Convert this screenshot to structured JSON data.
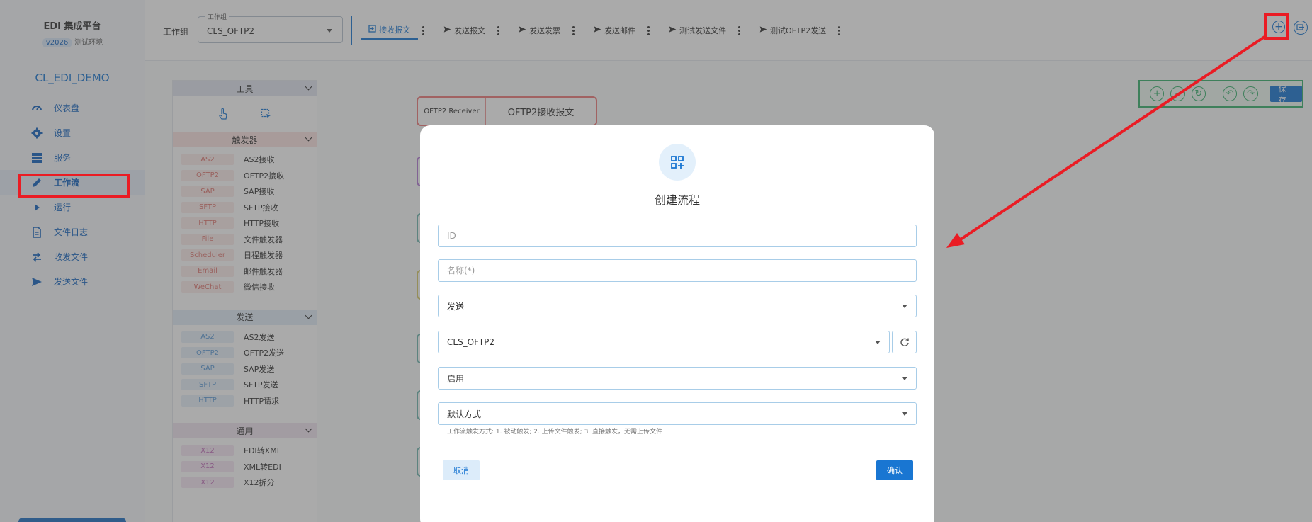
{
  "brand": {
    "title": "EDI 集成平台",
    "version": "v2026",
    "env": "测试环境"
  },
  "org_name": "CL_EDI_DEMO",
  "nav": [
    {
      "label": "仪表盘",
      "icon": "dashboard-icon"
    },
    {
      "label": "设置",
      "icon": "gear-icon"
    },
    {
      "label": "服务",
      "icon": "server-icon"
    },
    {
      "label": "工作流",
      "icon": "pencil-icon"
    },
    {
      "label": "运行",
      "icon": "play-icon"
    },
    {
      "label": "文件日志",
      "icon": "file-log-icon"
    },
    {
      "label": "收发文件",
      "icon": "transfer-icon"
    },
    {
      "label": "发送文件",
      "icon": "send-icon"
    }
  ],
  "topbar": {
    "group_label": "工作组",
    "group_select": {
      "legend": "工作组",
      "value": "CLS_OFTP2"
    },
    "tabs": [
      {
        "label": "接收报文",
        "icon": "login-icon"
      },
      {
        "label": "发送报文",
        "icon": "send-icon"
      },
      {
        "label": "发送发票",
        "icon": "send-icon"
      },
      {
        "label": "发送邮件",
        "icon": "send-icon"
      },
      {
        "label": "测试发送文件",
        "icon": "send-icon"
      },
      {
        "label": "测试OFTP2发送",
        "icon": "send-icon"
      }
    ],
    "add_symbol": "+"
  },
  "toolbox": {
    "tools_title": "工具",
    "triggers_title": "触发器",
    "triggers": [
      {
        "tag": "AS2",
        "name": "AS2接收"
      },
      {
        "tag": "OFTP2",
        "name": "OFTP2接收"
      },
      {
        "tag": "SAP",
        "name": "SAP接收"
      },
      {
        "tag": "SFTP",
        "name": "SFTP接收"
      },
      {
        "tag": "HTTP",
        "name": "HTTP接收"
      },
      {
        "tag": "File",
        "name": "文件触发器"
      },
      {
        "tag": "Scheduler",
        "name": "日程触发器"
      },
      {
        "tag": "Email",
        "name": "邮件触发器"
      },
      {
        "tag": "WeChat",
        "name": "微信接收"
      }
    ],
    "send_title": "发送",
    "senders": [
      {
        "tag": "AS2",
        "name": "AS2发送"
      },
      {
        "tag": "OFTP2",
        "name": "OFTP2发送"
      },
      {
        "tag": "SAP",
        "name": "SAP发送"
      },
      {
        "tag": "SFTP",
        "name": "SFTP发送"
      },
      {
        "tag": "HTTP",
        "name": "HTTP请求"
      }
    ],
    "general_title": "通用",
    "general": [
      {
        "tag": "X12",
        "name": "EDI转XML"
      },
      {
        "tag": "X12",
        "name": "XML转EDI"
      },
      {
        "tag": "X12",
        "name": "X12拆分"
      }
    ]
  },
  "canvas": {
    "node": {
      "tag": "OFTP2 Receiver",
      "title": "OFTP2接收报文"
    },
    "save_label": "保存"
  },
  "dialog": {
    "title": "创建流程",
    "id_placeholder": "ID",
    "name_placeholder": "名称(*)",
    "direction": "发送",
    "group": "CLS_OFTP2",
    "status": "启用",
    "trigger_mode": "默认方式",
    "hint": "工作流触发方式: 1. 被动触发; 2. 上传文件触发; 3. 直接触发，无需上传文件",
    "cancel_label": "取消",
    "ok_label": "确认"
  },
  "colors": {
    "primary": "#1976d2",
    "annotation": "#ea1c24",
    "flow_toolbar": "#38b26e"
  }
}
